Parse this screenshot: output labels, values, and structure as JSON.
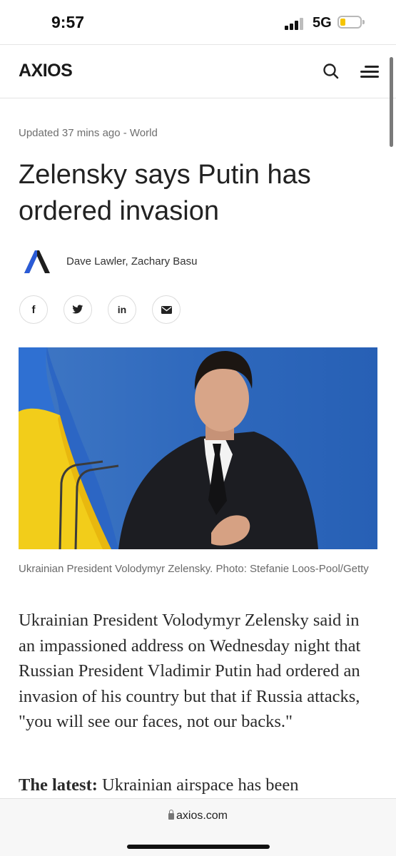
{
  "status_bar": {
    "time": "9:57",
    "network": "5G"
  },
  "site": {
    "logo_text": "AXIOS",
    "brand_color": "#2a5bd7"
  },
  "icons": [
    "search-icon",
    "menu-icon",
    "facebook-icon",
    "twitter-icon",
    "linkedin-icon",
    "email-icon",
    "lock-icon"
  ],
  "article": {
    "meta": "Updated 37 mins ago - World",
    "headline": "Zelensky says Putin has ordered invasion",
    "authors": "Dave Lawler, Zachary Basu",
    "share": {
      "facebook": "f",
      "linkedin": "in"
    },
    "caption": "Ukrainian President Volodymyr Zelensky. Photo: Stefanie Loos-Pool/Getty",
    "paragraph": "Ukrainian President Volodymyr Zelensky said in an impassioned address on Wednesday night that Russian President Vladimir Putin had ordered an invasion of his country but that if Russia attacks, \"you will see our faces, not our backs.\"",
    "latest_label": "The latest:",
    "latest_text": " Ukrainian airspace has been"
  },
  "browser": {
    "url": "axios.com"
  }
}
